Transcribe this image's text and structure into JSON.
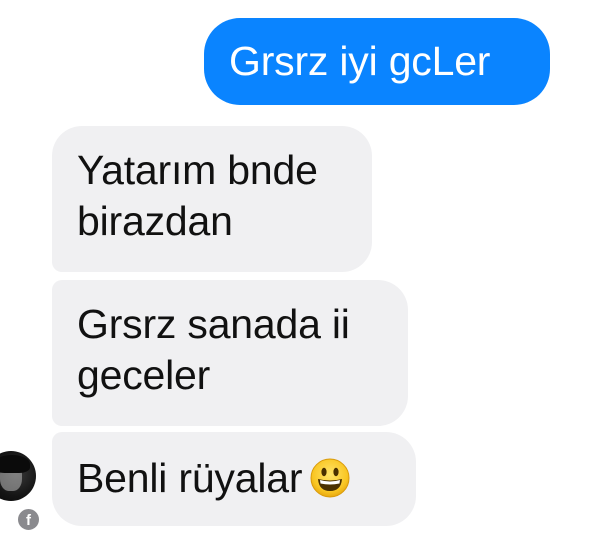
{
  "messages": [
    {
      "direction": "outgoing",
      "text": "Grsrz iyi gcLer"
    },
    {
      "direction": "incoming",
      "lines": [
        "Yatarım bnde",
        "birazdan"
      ]
    },
    {
      "direction": "incoming",
      "lines": [
        "Grsrz sanada ii",
        "geceler"
      ]
    },
    {
      "direction": "incoming",
      "text": "Benli rüyalar",
      "emoji": "grinning-face-emoji"
    }
  ],
  "avatar": {
    "badge_icon": "facebook-icon",
    "badge_glyph": "f"
  },
  "colors": {
    "outgoing_bubble": "#0a84ff",
    "incoming_bubble": "#f0f0f2",
    "background": "#ffffff"
  }
}
